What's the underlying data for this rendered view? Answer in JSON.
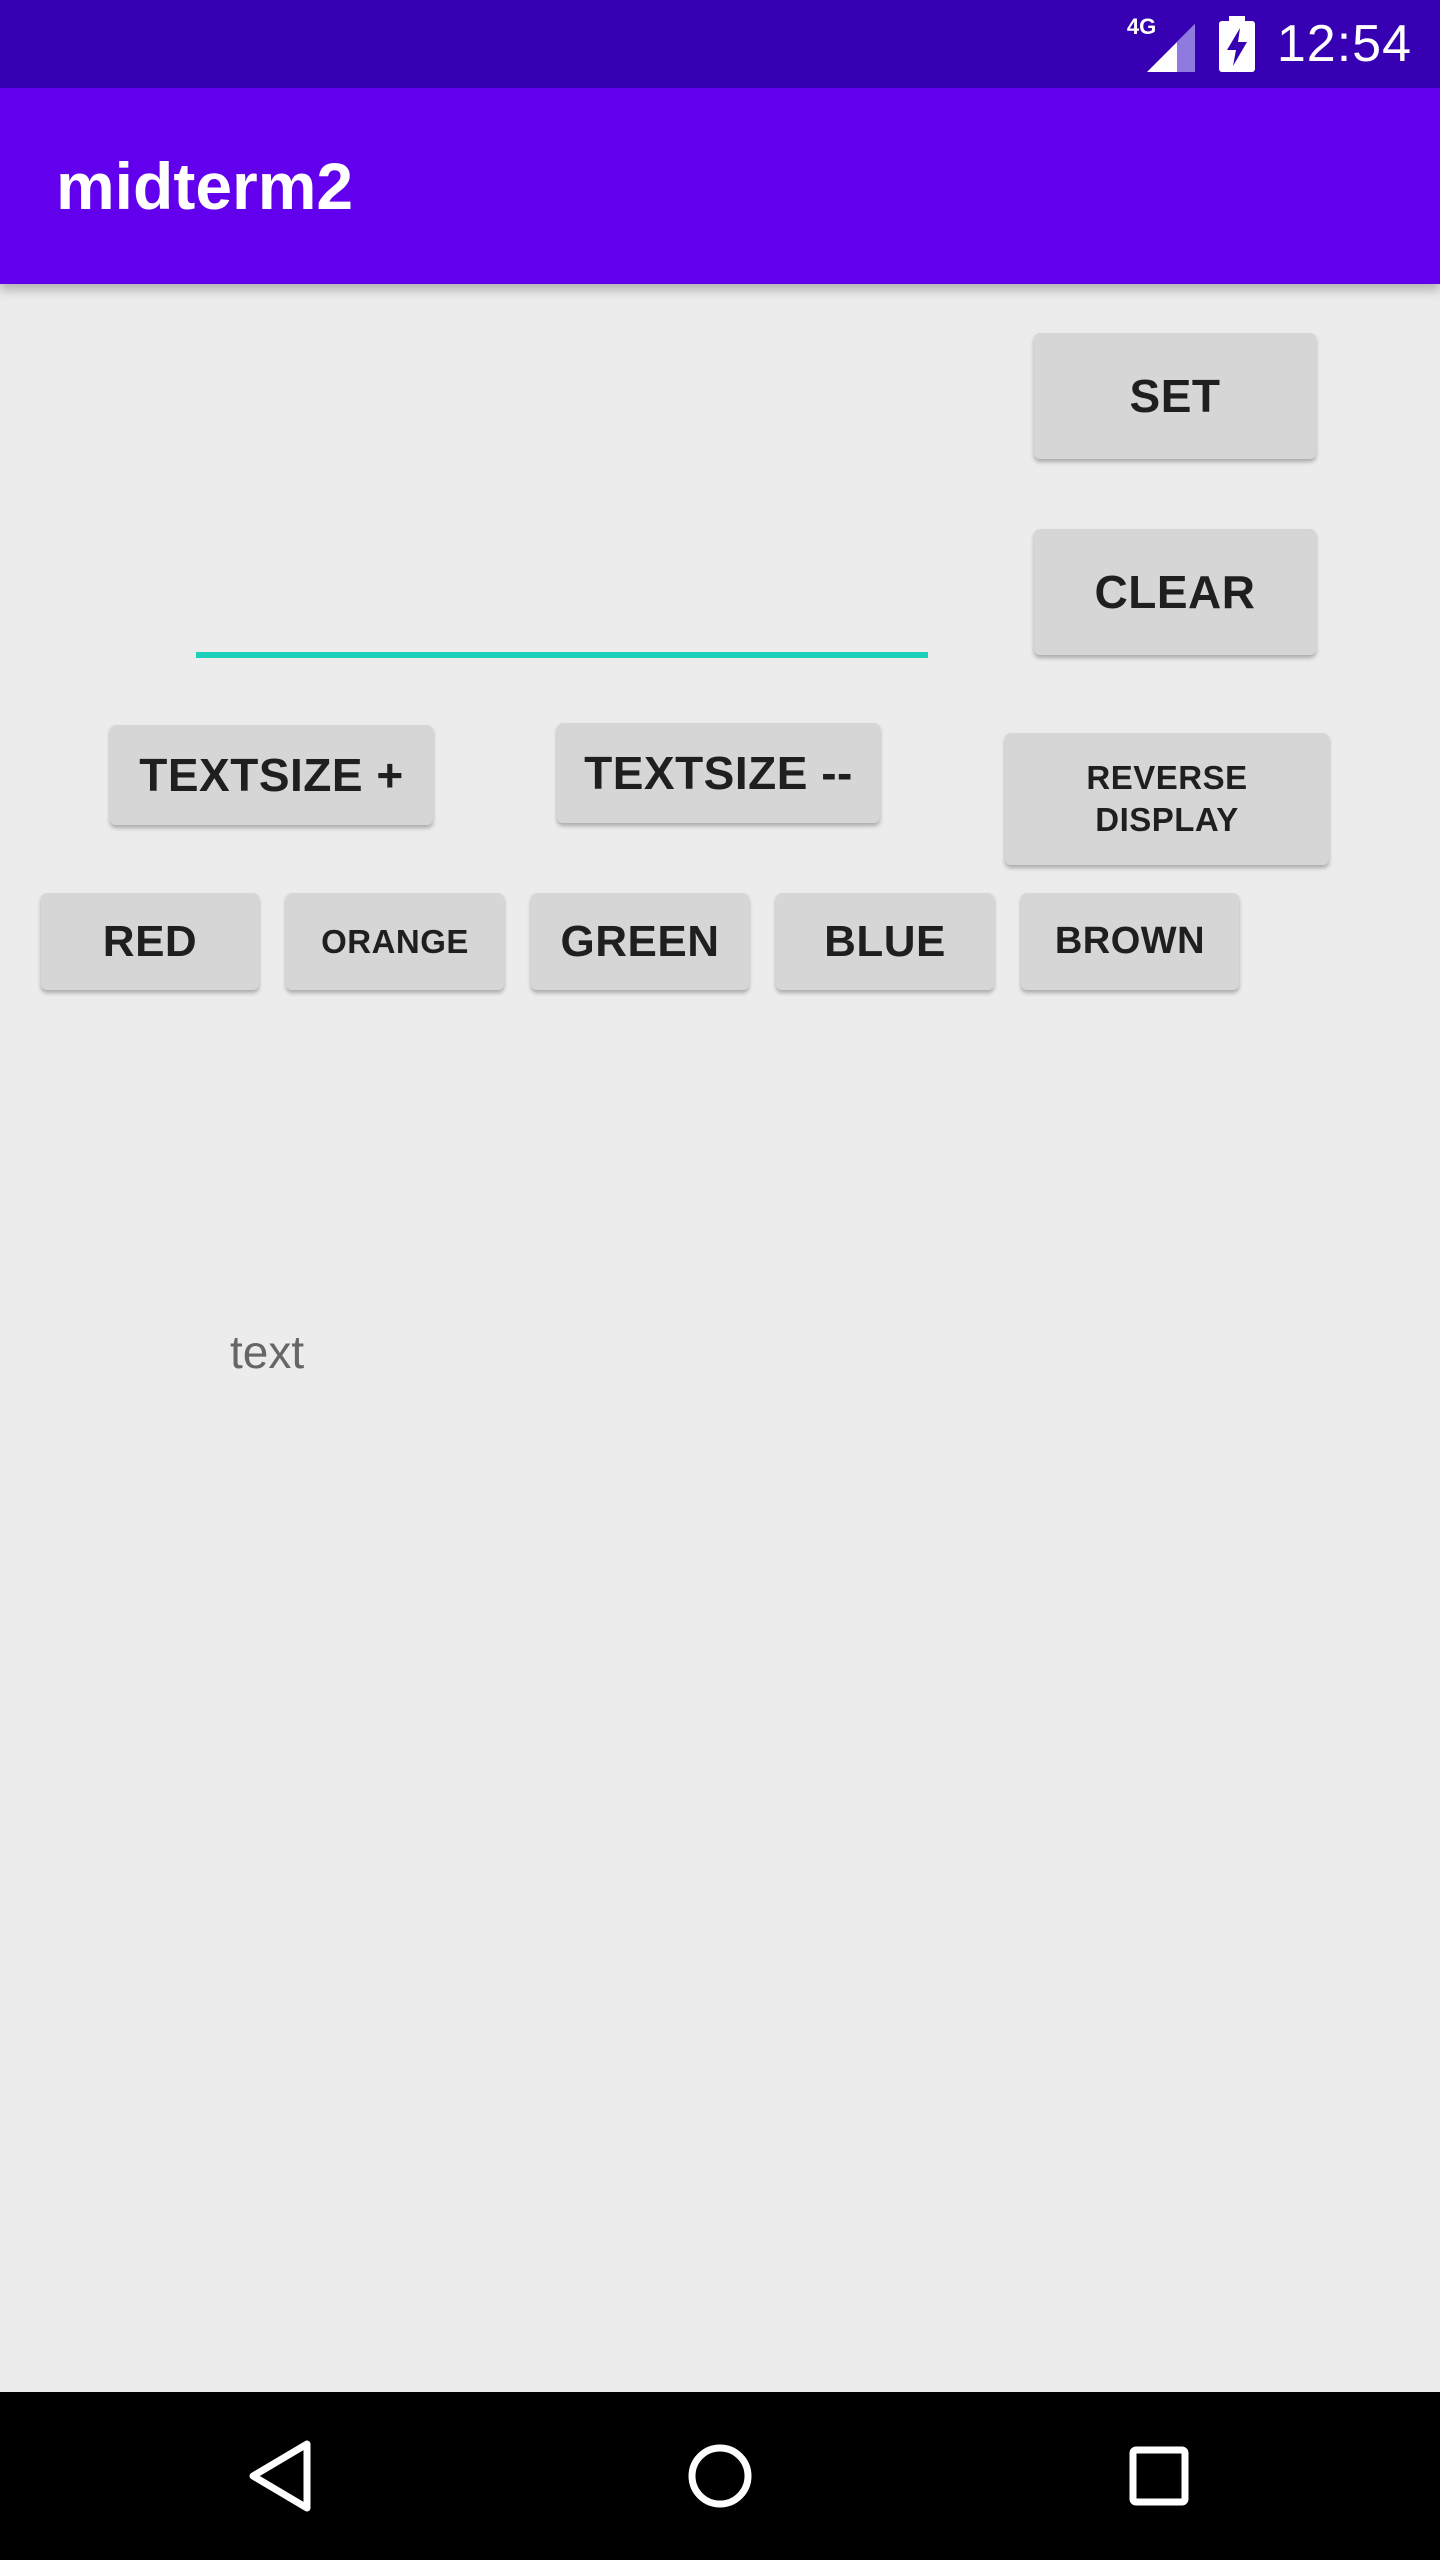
{
  "status_bar": {
    "network": "4G",
    "time": "12:54",
    "icons": [
      "signal-icon",
      "battery-charging-icon"
    ]
  },
  "app_bar": {
    "title": "midterm2"
  },
  "input": {
    "value": "",
    "placeholder": ""
  },
  "buttons": {
    "set": "SET",
    "clear": "CLEAR",
    "textsize_plus": "TEXTSIZE +",
    "textsize_minus": "TEXTSIZE --",
    "reverse_display": "REVERSE DISPLAY",
    "red": "RED",
    "orange": "ORANGE",
    "green": "GREEN",
    "blue": "BLUE",
    "brown": "BROWN"
  },
  "display": {
    "text": "text"
  },
  "nav_bar": {
    "icons": [
      "back-icon",
      "home-icon",
      "recents-icon"
    ]
  },
  "colors": {
    "status_bar": "#3700b3",
    "app_bar": "#6200ee",
    "accent": "#1ccfb8",
    "background": "#ececec",
    "button": "#d6d6d6"
  }
}
